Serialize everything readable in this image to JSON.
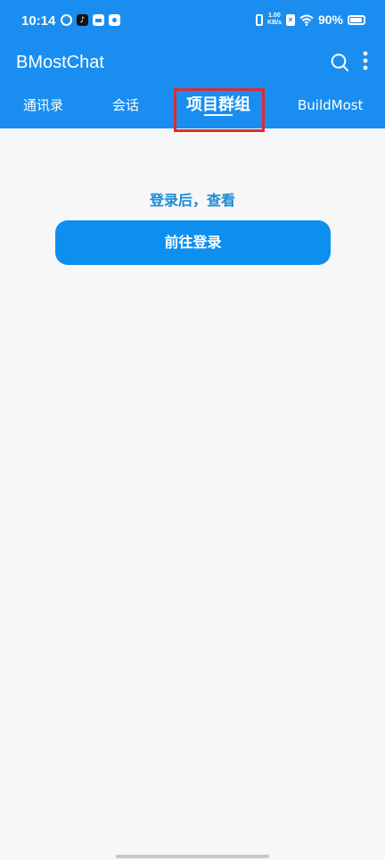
{
  "status_bar": {
    "time": "10:14",
    "net_speed_value": "1.00",
    "net_speed_unit": "KB/s",
    "battery": "90%",
    "notification_icons": [
      "sync-icon",
      "tiktok-icon",
      "mail-icon",
      "message-icon"
    ],
    "system_icons": [
      "vibrate-icon",
      "sim-off-icon",
      "wifi-icon",
      "battery-icon"
    ]
  },
  "appbar": {
    "title": "BMostChat",
    "icons": [
      "search-icon",
      "more-icon"
    ]
  },
  "tabs": [
    {
      "label": "通讯录",
      "active": false
    },
    {
      "label": "会话",
      "active": false
    },
    {
      "label": "项目群组",
      "active": true
    },
    {
      "label": "BuildMost",
      "active": false
    }
  ],
  "main": {
    "hint": "登录后，查看",
    "login_button": "前往登录"
  },
  "colors": {
    "primary": "#1a8ef0",
    "button": "#0d8ff0",
    "hint_text": "#1a8ad6",
    "highlight": "#e02a30",
    "background": "#f7f7f7"
  }
}
